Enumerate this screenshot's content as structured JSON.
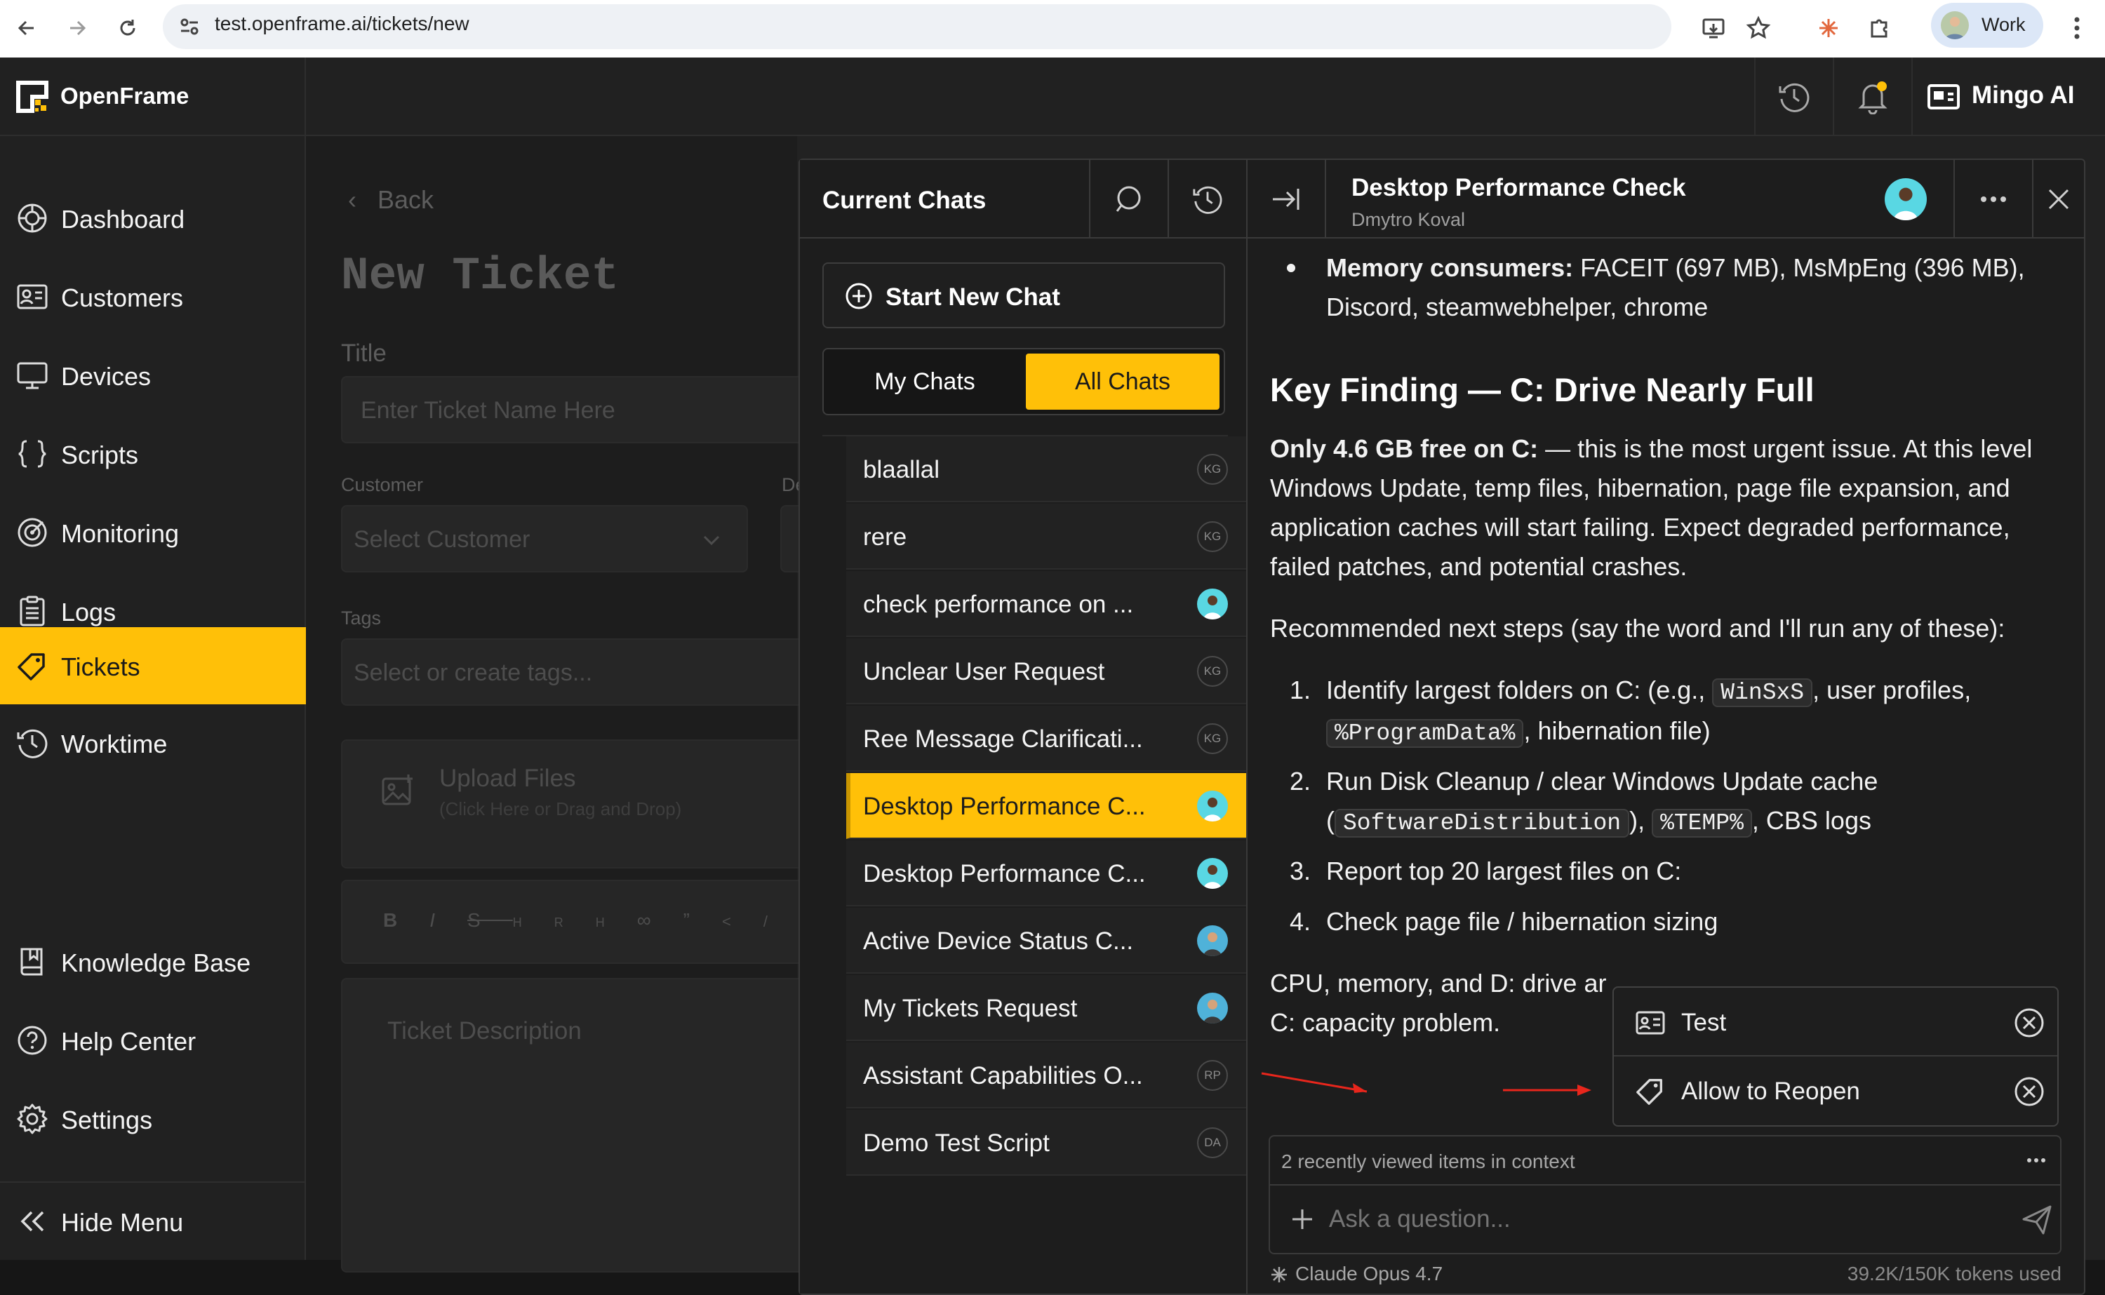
{
  "browser": {
    "url": "test.openframe.ai/tickets/new",
    "profile": "Work"
  },
  "app": {
    "brand": "OpenFrame",
    "user_name": "Mingo AI"
  },
  "sidebar": {
    "items": [
      {
        "label": "Dashboard",
        "icon": "dashboard-icon"
      },
      {
        "label": "Customers",
        "icon": "customers-icon"
      },
      {
        "label": "Devices",
        "icon": "monitor-icon"
      },
      {
        "label": "Scripts",
        "icon": "braces-icon"
      },
      {
        "label": "Monitoring",
        "icon": "monitoring-icon"
      },
      {
        "label": "Logs",
        "icon": "clipboard-icon"
      },
      {
        "label": "Tickets",
        "icon": "tag-icon"
      },
      {
        "label": "Worktime",
        "icon": "clock-icon"
      }
    ],
    "bottom_items": [
      {
        "label": "Knowledge Base",
        "icon": "book-icon"
      },
      {
        "label": "Help Center",
        "icon": "help-icon"
      },
      {
        "label": "Settings",
        "icon": "gear-icon"
      }
    ],
    "hide_menu": "Hide Menu",
    "active": "Tickets"
  },
  "ticket_page": {
    "back": "Back",
    "title": "New Ticket",
    "title_label": "Title",
    "title_placeholder": "Enter Ticket Name Here",
    "customer_label": "Customer",
    "customer_placeholder": "Select Customer",
    "device_label_partial": "De",
    "tags_label": "Tags",
    "tags_placeholder": "Select or create tags...",
    "upload_title": "Upload Files",
    "upload_hint": "(Click Here or Drag and Drop)",
    "description_placeholder": "Ticket Description",
    "toolbar": [
      "B",
      "I",
      "S",
      "HR",
      "H",
      "link",
      "quote",
      "code"
    ]
  },
  "chats": {
    "header": "Current Chats",
    "new_chat": "Start New Chat",
    "tabs": [
      "My Chats",
      "All Chats"
    ],
    "active_tab": "All Chats",
    "items": [
      {
        "title": "blaallal",
        "avatar": "KG",
        "avatar_type": "initials"
      },
      {
        "title": "rere",
        "avatar": "KG",
        "avatar_type": "initials"
      },
      {
        "title": "check performance on ...",
        "avatar": "",
        "avatar_type": "photo"
      },
      {
        "title": "Unclear User Request",
        "avatar": "KG",
        "avatar_type": "initials"
      },
      {
        "title": "Ree Message Clarificati...",
        "avatar": "KG",
        "avatar_type": "initials"
      },
      {
        "title": "Desktop Performance C...",
        "avatar": "",
        "avatar_type": "photo",
        "active": true
      },
      {
        "title": "Desktop Performance C...",
        "avatar": "",
        "avatar_type": "photo"
      },
      {
        "title": "Active Device Status C...",
        "avatar": "",
        "avatar_type": "photo"
      },
      {
        "title": "My Tickets Request",
        "avatar": "",
        "avatar_type": "photo"
      },
      {
        "title": "Assistant Capabilities O...",
        "avatar": "RP",
        "avatar_type": "initials"
      },
      {
        "title": "Demo Test Script",
        "avatar": "DA",
        "avatar_type": "initials"
      }
    ]
  },
  "conversation": {
    "title": "Desktop Performance Check",
    "subtitle": "Dmytro Koval",
    "bullet_label": "Memory consumers:",
    "bullet_text_1": " FACEIT (697 MB), MsMpEng (396 MB),",
    "bullet_text_2": "Discord, steamwebhelper, chrome",
    "heading": "Key Finding — C: Drive Nearly Full",
    "para1_bold": "Only 4.6 GB free on C:",
    "para1_l1": " — this is the most urgent issue. At this level",
    "para1_l2": "Windows Update, temp files, hibernation, page file expansion, and",
    "para1_l3": "application caches will start failing. Expect degraded performance,",
    "para1_l4": "failed patches, and potential crashes.",
    "para2": "Recommended next steps (say the word and I'll run any of these):",
    "steps": {
      "s1_a": "Identify largest folders on C: (e.g.,",
      "s1_code1": "WinSxS",
      "s1_b": ", user profiles,",
      "s1_code2": "%ProgramData%",
      "s1_c": ", hibernation file)",
      "s2_a": "Run Disk Cleanup / clear Windows Update cache",
      "s2_code1": "SoftwareDistribution",
      "s2_code2": "%TEMP%",
      "s2_b": ", CBS logs",
      "s3": "Report top 20 largest files on C:",
      "s4": "Check page file / hibernation sizing"
    },
    "para3_l1": "CPU, memory, and D: drive ar",
    "para3_l2": "C: capacity problem."
  },
  "context_popup": {
    "items": [
      {
        "label": "Test",
        "icon": "id-card-icon"
      },
      {
        "label": "Allow to Reopen",
        "icon": "tag-icon"
      }
    ]
  },
  "composer": {
    "context_text": "2 recently viewed items in context",
    "placeholder": "Ask a question...",
    "model": "Claude Opus 4.7",
    "tokens": "39.2K/150K tokens used"
  },
  "colors": {
    "accent": "#ffc008",
    "annotation_arrow": "#e8261c"
  }
}
